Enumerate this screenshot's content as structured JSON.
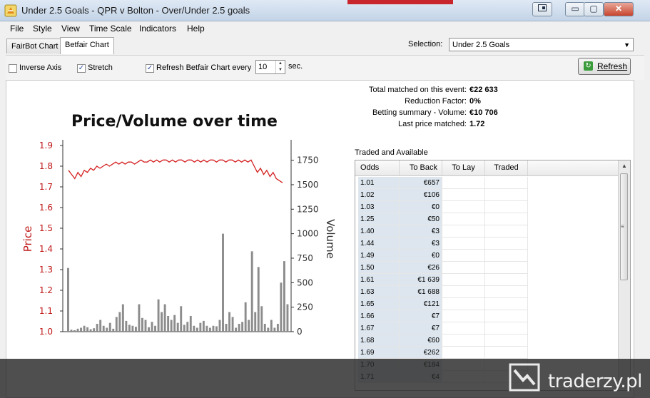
{
  "window": {
    "title": "Under 2.5 Goals - QPR v Bolton - Over/Under 2.5 goals",
    "minimize": "▭",
    "restore": "▢",
    "close": "✕"
  },
  "menu": [
    "File",
    "Style",
    "View",
    "Time Scale",
    "Indicators",
    "Help"
  ],
  "tabs": [
    {
      "label": "FairBot Chart",
      "active": false
    },
    {
      "label": "Betfair Chart",
      "active": true
    }
  ],
  "selection": {
    "label": "Selection:",
    "value": "Under 2.5 Goals"
  },
  "toolbar": {
    "inverse_axis": {
      "label": "Inverse Axis",
      "checked": false
    },
    "stretch": {
      "label": "Stretch",
      "checked": true
    },
    "refresh_every": {
      "label": "Refresh Betfair Chart every",
      "checked": true,
      "value": "10",
      "unit": "sec."
    },
    "refresh_button": "Refresh"
  },
  "stats": [
    {
      "label": "Total matched on this event:",
      "value": "€22 633"
    },
    {
      "label": "Reduction Factor:",
      "value": "0%"
    },
    {
      "label": "Betting summary - Volume:",
      "value": "€10 706"
    },
    {
      "label": "Last price matched:",
      "value": "1.72"
    }
  ],
  "table": {
    "caption": "Traded and Available",
    "columns": [
      "Odds",
      "To Back",
      "To Lay",
      "Traded"
    ],
    "rows": [
      [
        "1.01",
        "€657"
      ],
      [
        "1.02",
        "€106"
      ],
      [
        "1.03",
        "€0"
      ],
      [
        "1.25",
        "€50"
      ],
      [
        "1.40",
        "€3"
      ],
      [
        "1.44",
        "€3"
      ],
      [
        "1.49",
        "€0"
      ],
      [
        "1.50",
        "€26"
      ],
      [
        "1.61",
        "€1 639"
      ],
      [
        "1.63",
        "€1 688"
      ],
      [
        "1.65",
        "€121"
      ],
      [
        "1.66",
        "€7"
      ],
      [
        "1.67",
        "€7"
      ],
      [
        "1.68",
        "€60"
      ],
      [
        "1.69",
        "€262"
      ],
      [
        "1.70",
        "€184"
      ],
      [
        "1.71",
        "€4"
      ]
    ]
  },
  "watermark": "traderzy.pl",
  "colors": {
    "price_line": "#d42020",
    "volume_bar": "#8c8c8c",
    "price_axis": "#c01818"
  },
  "chart_data": {
    "type": "line",
    "title": "Price/Volume over time",
    "ylabel": "Price",
    "y2label": "Volume",
    "ylim": [
      1.0,
      1.9
    ],
    "y2lim": [
      0,
      1900
    ],
    "yticks": [
      "1.9",
      "1.8",
      "1.7",
      "1.6",
      "1.5",
      "1.4",
      "1.3",
      "1.2",
      "1.1",
      "1.0"
    ],
    "y2ticks": [
      "1750",
      "1500",
      "1250",
      "1000",
      "750",
      "500",
      "250",
      "0"
    ],
    "series": [
      {
        "type": "line",
        "values": [
          1.78,
          1.76,
          1.74,
          1.77,
          1.75,
          1.78,
          1.77,
          1.79,
          1.78,
          1.8,
          1.79,
          1.8,
          1.81,
          1.8,
          1.81,
          1.82,
          1.81,
          1.82,
          1.81,
          1.82,
          1.82,
          1.81,
          1.82,
          1.83,
          1.82,
          1.82,
          1.83,
          1.82,
          1.83,
          1.82,
          1.83,
          1.83,
          1.82,
          1.83,
          1.82,
          1.83,
          1.83,
          1.82,
          1.83,
          1.83,
          1.82,
          1.83,
          1.82,
          1.83,
          1.82,
          1.83,
          1.83,
          1.82,
          1.83,
          1.83,
          1.82,
          1.83,
          1.83,
          1.82,
          1.83,
          1.82,
          1.83,
          1.82,
          1.83,
          1.8,
          1.77,
          1.79,
          1.76,
          1.78,
          1.75,
          1.77,
          1.74,
          1.73,
          1.72
        ]
      },
      {
        "type": "bar",
        "values": [
          650,
          20,
          15,
          30,
          40,
          60,
          45,
          25,
          35,
          80,
          120,
          60,
          40,
          90,
          30,
          150,
          200,
          280,
          110,
          70,
          60,
          50,
          280,
          140,
          120,
          45,
          100,
          60,
          330,
          200,
          280,
          160,
          120,
          170,
          90,
          260,
          70,
          100,
          160,
          60,
          40,
          90,
          110,
          60,
          40,
          60,
          55,
          120,
          1000,
          80,
          200,
          150,
          40,
          80,
          100,
          300,
          120,
          820,
          200,
          660,
          260,
          80,
          40,
          120,
          40,
          80,
          500,
          720,
          280
        ]
      }
    ]
  }
}
